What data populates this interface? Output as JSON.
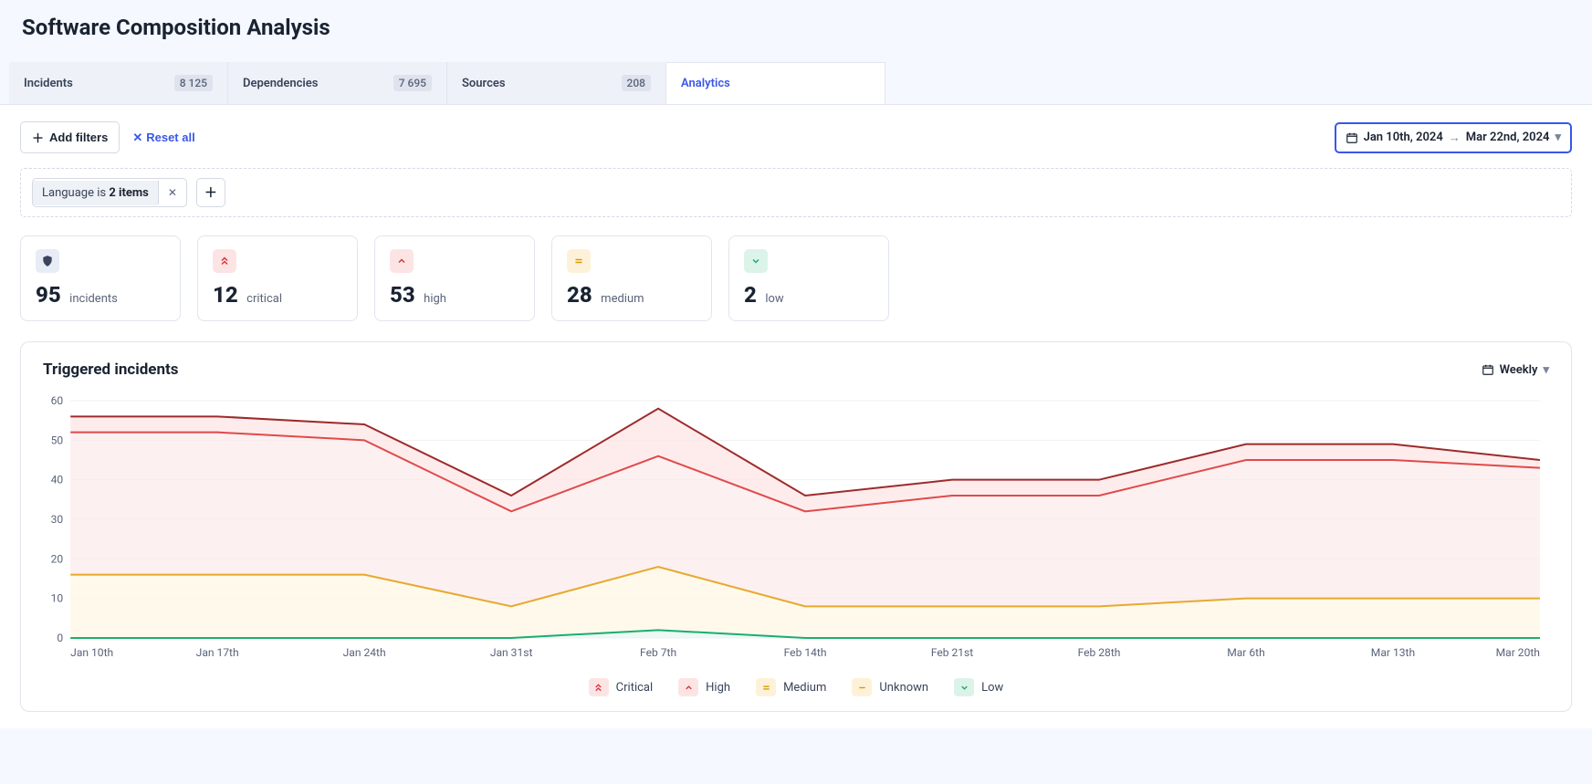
{
  "page": {
    "title": "Software Composition Analysis"
  },
  "tabs": [
    {
      "label": "Incidents",
      "count": "8 125"
    },
    {
      "label": "Dependencies",
      "count": "7 695"
    },
    {
      "label": "Sources",
      "count": "208"
    },
    {
      "label": "Analytics"
    }
  ],
  "toolbar": {
    "add_filters_label": "Add filters",
    "reset_label": "Reset all",
    "date_from": "Jan 10th, 2024",
    "date_to": "Mar 22nd, 2024"
  },
  "filters": {
    "chip_prefix": "Language is ",
    "chip_value": "2 items"
  },
  "stats": {
    "incidents": {
      "value": "95",
      "label": "incidents"
    },
    "critical": {
      "value": "12",
      "label": "critical"
    },
    "high": {
      "value": "53",
      "label": "high"
    },
    "medium": {
      "value": "28",
      "label": "medium"
    },
    "low": {
      "value": "2",
      "label": "low"
    }
  },
  "chart": {
    "title": "Triggered incidents",
    "interval": "Weekly",
    "legend": {
      "critical": "Critical",
      "high": "High",
      "medium": "Medium",
      "unknown": "Unknown",
      "low": "Low"
    }
  },
  "chart_data": {
    "type": "area",
    "title": "Triggered incidents",
    "xlabel": "",
    "ylabel": "",
    "ylim": [
      0,
      60
    ],
    "y_ticks": [
      0,
      10,
      20,
      30,
      40,
      50,
      60
    ],
    "categories": [
      "Jan 10th",
      "Jan 17th",
      "Jan 24th",
      "Jan 31st",
      "Feb 7th",
      "Feb 14th",
      "Feb 21st",
      "Feb 28th",
      "Mar 6th",
      "Mar 13th",
      "Mar 20th"
    ],
    "series": [
      {
        "name": "Critical (stacked top)",
        "color": "#9e2a2a",
        "fill": "#fde4e4",
        "values": [
          56,
          56,
          54,
          36,
          58,
          36,
          40,
          40,
          49,
          49,
          45
        ]
      },
      {
        "name": "High (stacked)",
        "color": "#e04a4a",
        "fill": "#fceaea",
        "values": [
          52,
          52,
          50,
          32,
          46,
          32,
          36,
          36,
          45,
          45,
          43
        ]
      },
      {
        "name": "Medium (stacked)",
        "color": "#e7a92e",
        "fill": "#fef6e3",
        "values": [
          16,
          16,
          16,
          8,
          18,
          8,
          8,
          8,
          10,
          10,
          10
        ]
      },
      {
        "name": "Low (stacked bottom)",
        "color": "#1aae6f",
        "fill": "#e6f7ef",
        "values": [
          0,
          0,
          0,
          0,
          2,
          0,
          0,
          0,
          0,
          0,
          0
        ]
      }
    ]
  }
}
